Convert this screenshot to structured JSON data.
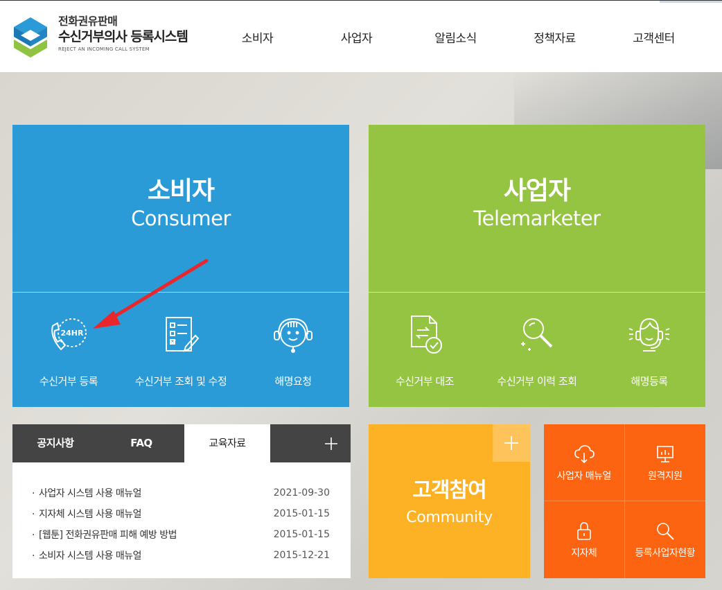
{
  "header": {
    "logo": {
      "line1": "전화권유판매",
      "line2": "수신거부의사 등록시스템",
      "line3": "REJECT AN INCOMING CALL SYSTEM"
    },
    "nav": [
      "소비자",
      "사업자",
      "알림소식",
      "정책자료",
      "고객센터"
    ]
  },
  "consumer": {
    "title": "소비자",
    "subtitle": "Consumer",
    "items": [
      {
        "label": "수신거부 등록",
        "icon": "phone-24hr-icon",
        "badge": "24HR"
      },
      {
        "label": "수신거부 조회 및 수정",
        "icon": "checklist-icon"
      },
      {
        "label": "해명요청",
        "icon": "headset-icon"
      }
    ]
  },
  "telemarketer": {
    "title": "사업자",
    "subtitle": "Telemarketer",
    "items": [
      {
        "label": "수신거부 대조",
        "icon": "document-compare-icon"
      },
      {
        "label": "수신거부 이력 조회",
        "icon": "magnifier-icon"
      },
      {
        "label": "해명등록",
        "icon": "agent-headset-icon"
      }
    ]
  },
  "board": {
    "tabs": [
      "공지사항",
      "FAQ",
      "교육자료"
    ],
    "active_tab": "교육자료",
    "rows": [
      {
        "title": "사업자 시스템 사용 매뉴얼",
        "date": "2021-09-30"
      },
      {
        "title": "지자체 시스템 사용 매뉴얼",
        "date": "2015-01-15"
      },
      {
        "title": "[웹툰] 전화권유판매 피해 예방 방법",
        "date": "2015-01-15"
      },
      {
        "title": "소비자 시스템 사용 매뉴얼",
        "date": "2015-12-21"
      }
    ]
  },
  "community": {
    "title": "고객참여",
    "subtitle": "Community"
  },
  "quick": [
    {
      "label": "사업자 매뉴얼",
      "icon": "cloud-download-icon"
    },
    {
      "label": "원격지원",
      "icon": "monitor-icon"
    },
    {
      "label": "지자체",
      "icon": "lock-icon"
    },
    {
      "label": "등록사업자현황",
      "icon": "search-icon"
    }
  ],
  "colors": {
    "consumer": "#2b9bd8",
    "telemarketer": "#94c442",
    "community": "#fdb124",
    "quick": "#fc6411",
    "board_tabs": "#444444",
    "annotation_arrow": "#e8262c"
  }
}
